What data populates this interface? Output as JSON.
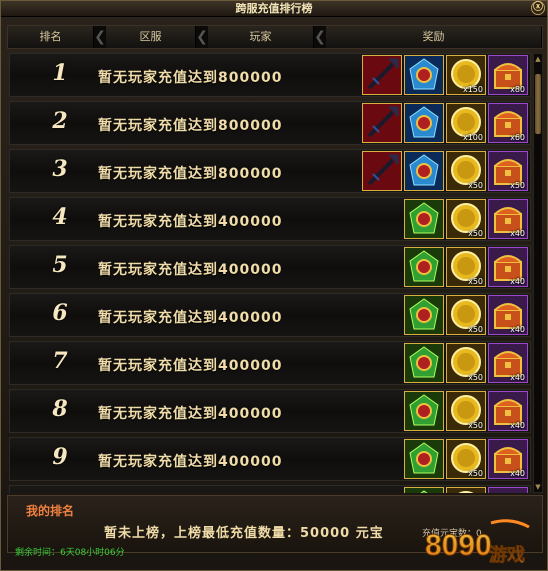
{
  "window": {
    "title": "跨服充值排行榜",
    "close_glyph": "ⓧ"
  },
  "header": {
    "rank": "排名",
    "server": "区服",
    "player": "玩家",
    "reward": "奖励"
  },
  "rows": [
    {
      "rank": "1",
      "cond": "暂无玩家充值达到",
      "amount": "800000",
      "rewards": [
        {
          "icon": "trident-weapon-icon",
          "qty": ""
        },
        {
          "icon": "blue-gem-icon",
          "qty": ""
        },
        {
          "icon": "gold-coin-icon",
          "qty": "x150"
        },
        {
          "icon": "treasure-chest-icon",
          "qty": "x80"
        }
      ]
    },
    {
      "rank": "2",
      "cond": "暂无玩家充值达到",
      "amount": "800000",
      "rewards": [
        {
          "icon": "trident-weapon-icon",
          "qty": ""
        },
        {
          "icon": "blue-gem-icon",
          "qty": ""
        },
        {
          "icon": "gold-coin-icon",
          "qty": "x100"
        },
        {
          "icon": "treasure-chest-icon",
          "qty": "x60"
        }
      ]
    },
    {
      "rank": "3",
      "cond": "暂无玩家充值达到",
      "amount": "800000",
      "rewards": [
        {
          "icon": "trident-weapon-icon",
          "qty": ""
        },
        {
          "icon": "blue-gem-icon",
          "qty": ""
        },
        {
          "icon": "gold-coin-icon",
          "qty": "x50"
        },
        {
          "icon": "treasure-chest-icon",
          "qty": "x50"
        }
      ]
    },
    {
      "rank": "4",
      "cond": "暂无玩家充值达到",
      "amount": "400000",
      "rewards": [
        {
          "icon": "green-gem-icon",
          "qty": ""
        },
        {
          "icon": "gold-coin-icon",
          "qty": "x50"
        },
        {
          "icon": "treasure-chest-icon",
          "qty": "x40"
        }
      ]
    },
    {
      "rank": "5",
      "cond": "暂无玩家充值达到",
      "amount": "400000",
      "rewards": [
        {
          "icon": "green-gem-icon",
          "qty": ""
        },
        {
          "icon": "gold-coin-icon",
          "qty": "x50"
        },
        {
          "icon": "treasure-chest-icon",
          "qty": "x40"
        }
      ]
    },
    {
      "rank": "6",
      "cond": "暂无玩家充值达到",
      "amount": "400000",
      "rewards": [
        {
          "icon": "green-gem-icon",
          "qty": ""
        },
        {
          "icon": "gold-coin-icon",
          "qty": "x50"
        },
        {
          "icon": "treasure-chest-icon",
          "qty": "x40"
        }
      ]
    },
    {
      "rank": "7",
      "cond": "暂无玩家充值达到",
      "amount": "400000",
      "rewards": [
        {
          "icon": "green-gem-icon",
          "qty": ""
        },
        {
          "icon": "gold-coin-icon",
          "qty": "x50"
        },
        {
          "icon": "treasure-chest-icon",
          "qty": "x40"
        }
      ]
    },
    {
      "rank": "8",
      "cond": "暂无玩家充值达到",
      "amount": "400000",
      "rewards": [
        {
          "icon": "green-gem-icon",
          "qty": ""
        },
        {
          "icon": "gold-coin-icon",
          "qty": "x50"
        },
        {
          "icon": "treasure-chest-icon",
          "qty": "x40"
        }
      ]
    },
    {
      "rank": "9",
      "cond": "暂无玩家充值达到",
      "amount": "400000",
      "rewards": [
        {
          "icon": "green-gem-icon",
          "qty": ""
        },
        {
          "icon": "gold-coin-icon",
          "qty": "x50"
        },
        {
          "icon": "treasure-chest-icon",
          "qty": "x40"
        }
      ]
    },
    {
      "rank": "10",
      "cond": "",
      "amount": "",
      "rewards": [
        {
          "icon": "green-gem-icon",
          "qty": ""
        },
        {
          "icon": "gold-coin-icon",
          "qty": ""
        },
        {
          "icon": "treasure-chest-icon",
          "qty": ""
        }
      ]
    }
  ],
  "my_rank": {
    "title": "我的排名",
    "text": "暂未上榜，上榜最低充值数量：50000 元宝",
    "side": "充值元宝数：0"
  },
  "footer": {
    "remaining": "剩余时间：6天08小时06分"
  },
  "watermark": {
    "text": "8090游戏"
  },
  "colors": {
    "accent": "#f08040",
    "timer": "#3ad03a",
    "frame_gold": "#d8b040",
    "frame_purple": "#9a4ac8"
  }
}
